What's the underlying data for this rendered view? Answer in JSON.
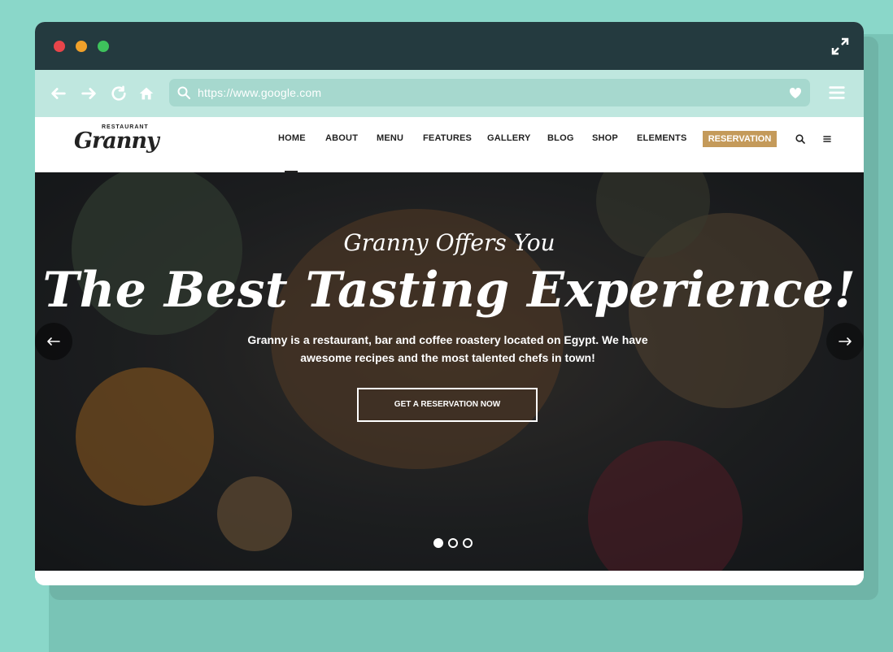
{
  "browser": {
    "url": "https://www.google.com",
    "buttons": [
      "back",
      "forward",
      "reload",
      "home"
    ]
  },
  "site": {
    "logo": {
      "small": "RESTAURANT",
      "big": "Granny"
    },
    "nav": [
      "HOME",
      "ABOUT",
      "MENU",
      "FEATURES",
      "GALLERY",
      "BLOG",
      "SHOP",
      "ELEMENTS"
    ],
    "reservation_label": "RESERVATION"
  },
  "hero": {
    "subtitle": "Granny Offers You",
    "title": "The Best Tasting Experience!",
    "description": "Granny is a restaurant, bar and coffee roastery located on Egypt. We have awesome recipes and the most talented chefs in town!",
    "cta": "GET A RESERVATION NOW",
    "slide_count": 3,
    "active_slide": 1
  },
  "colors": {
    "page_bg": "#8ad7c9",
    "titlebar": "#243a3f",
    "toolbar": "#bfe7df",
    "reservation": "#c49a5a"
  },
  "icons": {
    "titlebar": [
      "expand-icon"
    ],
    "toolbar": [
      "back-arrow-icon",
      "forward-arrow-icon",
      "reload-icon",
      "home-icon",
      "search-icon",
      "heart-icon",
      "menu-icon"
    ],
    "nav": [
      "search-icon",
      "hamburger-icon"
    ],
    "hero": [
      "prev-arrow-icon",
      "next-arrow-icon"
    ]
  }
}
